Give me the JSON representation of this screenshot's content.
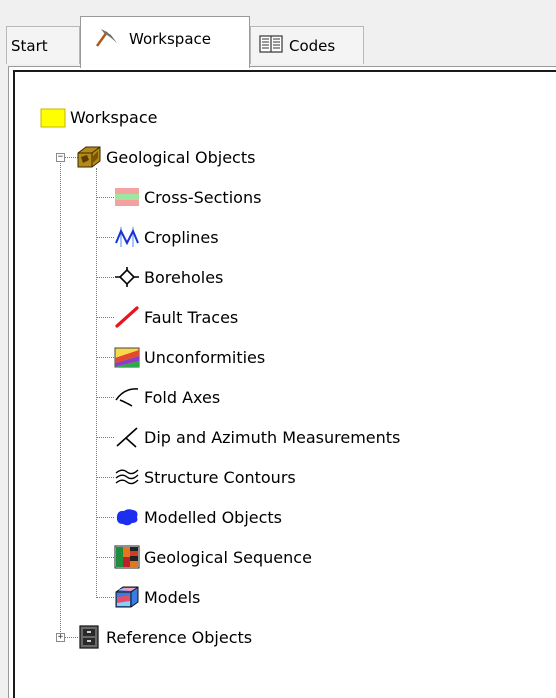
{
  "tabs": {
    "start": "Start",
    "workspace": "Workspace",
    "codes": "Codes"
  },
  "tree": {
    "root": "Workspace",
    "geological_objects": {
      "label": "Geological Objects",
      "expander": "−",
      "children": [
        {
          "label": "Cross-Sections",
          "icon": "cross-sections-icon"
        },
        {
          "label": "Croplines",
          "icon": "croplines-icon"
        },
        {
          "label": "Boreholes",
          "icon": "boreholes-icon"
        },
        {
          "label": "Fault Traces",
          "icon": "fault-traces-icon"
        },
        {
          "label": "Unconformities",
          "icon": "unconformities-icon"
        },
        {
          "label": "Fold Axes",
          "icon": "fold-axes-icon"
        },
        {
          "label": "Dip and Azimuth Measurements",
          "icon": "dip-azimuth-icon"
        },
        {
          "label": "Structure Contours",
          "icon": "structure-contours-icon"
        },
        {
          "label": "Modelled Objects",
          "icon": "modelled-objects-icon"
        },
        {
          "label": "Geological Sequence",
          "icon": "geological-sequence-icon"
        },
        {
          "label": "Models",
          "icon": "models-icon"
        }
      ]
    },
    "reference_objects": {
      "label": "Reference Objects",
      "expander": "+"
    }
  },
  "colors": {
    "folder": "#ffff00",
    "fault_trace": "#e8141e",
    "modelled_object": "#1c2ef0",
    "panel_background": "#ffffff"
  }
}
